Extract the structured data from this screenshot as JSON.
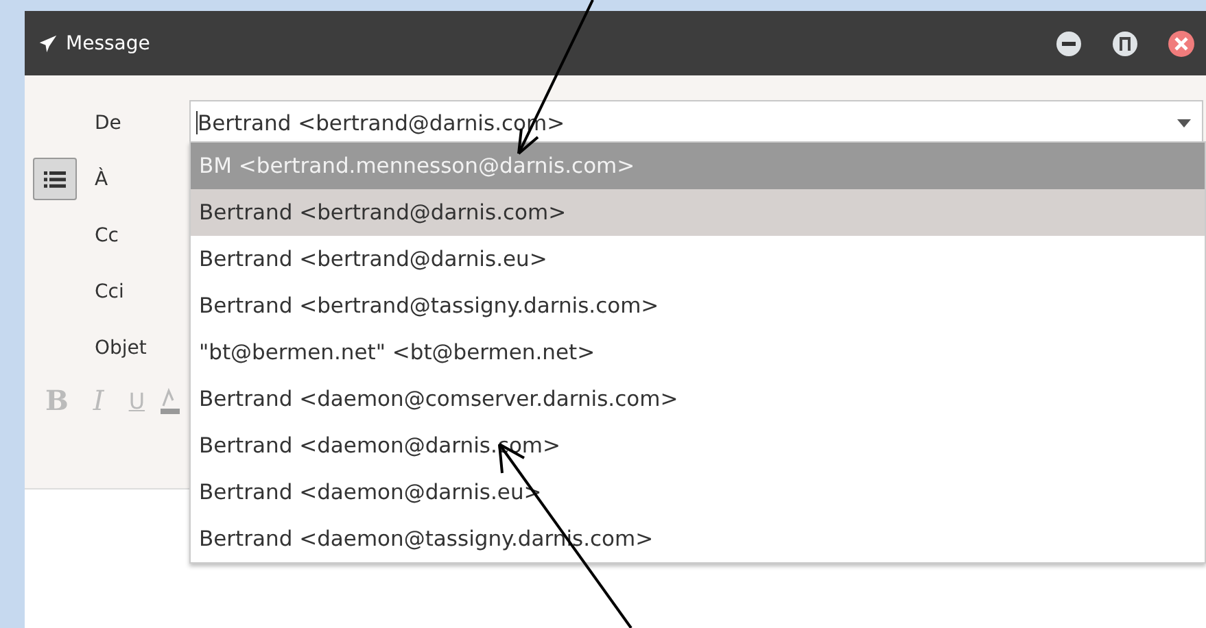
{
  "window": {
    "title": "Message"
  },
  "fields": [
    {
      "label": "De",
      "value": "Bertrand <bertrand@darnis.com>"
    },
    {
      "label": "À"
    },
    {
      "label": "Cc"
    },
    {
      "label": "Cci"
    },
    {
      "label": "Objet"
    }
  ],
  "recipient_list_button": {
    "selected": true
  },
  "format_buttons": [
    {
      "label": "B",
      "kind": "bold"
    },
    {
      "label": "I",
      "kind": "italic"
    },
    {
      "label": "U",
      "kind": "underline"
    }
  ],
  "dropdown": {
    "options": [
      {
        "text": "BM <bertrand.mennesson@darnis.com>",
        "hovered": true,
        "selected": false
      },
      {
        "text": "Bertrand <bertrand@darnis.com>",
        "hovered": false,
        "selected": true
      },
      {
        "text": "Bertrand <bertrand@darnis.eu>",
        "hovered": false,
        "selected": false
      },
      {
        "text": "Bertrand <bertrand@tassigny.darnis.com>",
        "hovered": false,
        "selected": false
      },
      {
        "text": "\"bt@bermen.net\" <bt@bermen.net>",
        "hovered": false,
        "selected": false
      },
      {
        "text": "Bertrand <daemon@comserver.darnis.com>",
        "hovered": false,
        "selected": false
      },
      {
        "text": "Bertrand <daemon@darnis.com>",
        "hovered": false,
        "selected": false
      },
      {
        "text": "Bertrand <daemon@darnis.eu>",
        "hovered": false,
        "selected": false
      },
      {
        "text": "Bertrand <daemon@tassigny.darnis.com>",
        "hovered": false,
        "selected": false
      }
    ]
  }
}
